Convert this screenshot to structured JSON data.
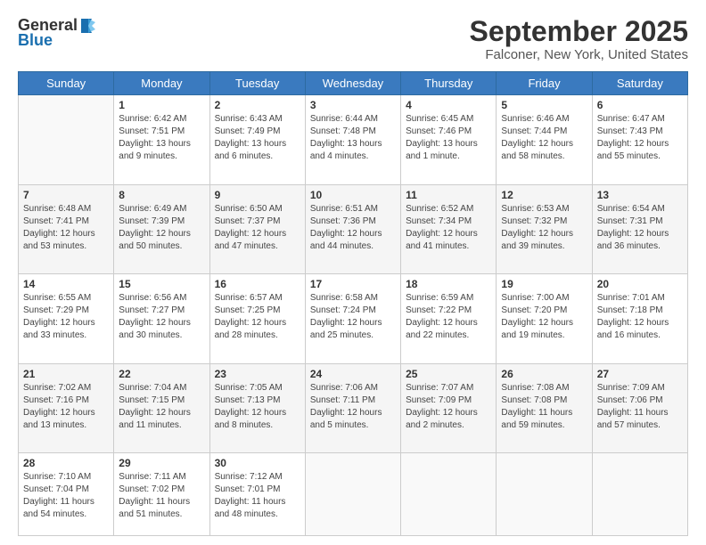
{
  "header": {
    "logo_general": "General",
    "logo_blue": "Blue",
    "month_title": "September 2025",
    "location": "Falconer, New York, United States"
  },
  "weekdays": [
    "Sunday",
    "Monday",
    "Tuesday",
    "Wednesday",
    "Thursday",
    "Friday",
    "Saturday"
  ],
  "weeks": [
    [
      {
        "day": "",
        "info": ""
      },
      {
        "day": "1",
        "info": "Sunrise: 6:42 AM\nSunset: 7:51 PM\nDaylight: 13 hours\nand 9 minutes."
      },
      {
        "day": "2",
        "info": "Sunrise: 6:43 AM\nSunset: 7:49 PM\nDaylight: 13 hours\nand 6 minutes."
      },
      {
        "day": "3",
        "info": "Sunrise: 6:44 AM\nSunset: 7:48 PM\nDaylight: 13 hours\nand 4 minutes."
      },
      {
        "day": "4",
        "info": "Sunrise: 6:45 AM\nSunset: 7:46 PM\nDaylight: 13 hours\nand 1 minute."
      },
      {
        "day": "5",
        "info": "Sunrise: 6:46 AM\nSunset: 7:44 PM\nDaylight: 12 hours\nand 58 minutes."
      },
      {
        "day": "6",
        "info": "Sunrise: 6:47 AM\nSunset: 7:43 PM\nDaylight: 12 hours\nand 55 minutes."
      }
    ],
    [
      {
        "day": "7",
        "info": "Sunrise: 6:48 AM\nSunset: 7:41 PM\nDaylight: 12 hours\nand 53 minutes."
      },
      {
        "day": "8",
        "info": "Sunrise: 6:49 AM\nSunset: 7:39 PM\nDaylight: 12 hours\nand 50 minutes."
      },
      {
        "day": "9",
        "info": "Sunrise: 6:50 AM\nSunset: 7:37 PM\nDaylight: 12 hours\nand 47 minutes."
      },
      {
        "day": "10",
        "info": "Sunrise: 6:51 AM\nSunset: 7:36 PM\nDaylight: 12 hours\nand 44 minutes."
      },
      {
        "day": "11",
        "info": "Sunrise: 6:52 AM\nSunset: 7:34 PM\nDaylight: 12 hours\nand 41 minutes."
      },
      {
        "day": "12",
        "info": "Sunrise: 6:53 AM\nSunset: 7:32 PM\nDaylight: 12 hours\nand 39 minutes."
      },
      {
        "day": "13",
        "info": "Sunrise: 6:54 AM\nSunset: 7:31 PM\nDaylight: 12 hours\nand 36 minutes."
      }
    ],
    [
      {
        "day": "14",
        "info": "Sunrise: 6:55 AM\nSunset: 7:29 PM\nDaylight: 12 hours\nand 33 minutes."
      },
      {
        "day": "15",
        "info": "Sunrise: 6:56 AM\nSunset: 7:27 PM\nDaylight: 12 hours\nand 30 minutes."
      },
      {
        "day": "16",
        "info": "Sunrise: 6:57 AM\nSunset: 7:25 PM\nDaylight: 12 hours\nand 28 minutes."
      },
      {
        "day": "17",
        "info": "Sunrise: 6:58 AM\nSunset: 7:24 PM\nDaylight: 12 hours\nand 25 minutes."
      },
      {
        "day": "18",
        "info": "Sunrise: 6:59 AM\nSunset: 7:22 PM\nDaylight: 12 hours\nand 22 minutes."
      },
      {
        "day": "19",
        "info": "Sunrise: 7:00 AM\nSunset: 7:20 PM\nDaylight: 12 hours\nand 19 minutes."
      },
      {
        "day": "20",
        "info": "Sunrise: 7:01 AM\nSunset: 7:18 PM\nDaylight: 12 hours\nand 16 minutes."
      }
    ],
    [
      {
        "day": "21",
        "info": "Sunrise: 7:02 AM\nSunset: 7:16 PM\nDaylight: 12 hours\nand 13 minutes."
      },
      {
        "day": "22",
        "info": "Sunrise: 7:04 AM\nSunset: 7:15 PM\nDaylight: 12 hours\nand 11 minutes."
      },
      {
        "day": "23",
        "info": "Sunrise: 7:05 AM\nSunset: 7:13 PM\nDaylight: 12 hours\nand 8 minutes."
      },
      {
        "day": "24",
        "info": "Sunrise: 7:06 AM\nSunset: 7:11 PM\nDaylight: 12 hours\nand 5 minutes."
      },
      {
        "day": "25",
        "info": "Sunrise: 7:07 AM\nSunset: 7:09 PM\nDaylight: 12 hours\nand 2 minutes."
      },
      {
        "day": "26",
        "info": "Sunrise: 7:08 AM\nSunset: 7:08 PM\nDaylight: 11 hours\nand 59 minutes."
      },
      {
        "day": "27",
        "info": "Sunrise: 7:09 AM\nSunset: 7:06 PM\nDaylight: 11 hours\nand 57 minutes."
      }
    ],
    [
      {
        "day": "28",
        "info": "Sunrise: 7:10 AM\nSunset: 7:04 PM\nDaylight: 11 hours\nand 54 minutes."
      },
      {
        "day": "29",
        "info": "Sunrise: 7:11 AM\nSunset: 7:02 PM\nDaylight: 11 hours\nand 51 minutes."
      },
      {
        "day": "30",
        "info": "Sunrise: 7:12 AM\nSunset: 7:01 PM\nDaylight: 11 hours\nand 48 minutes."
      },
      {
        "day": "",
        "info": ""
      },
      {
        "day": "",
        "info": ""
      },
      {
        "day": "",
        "info": ""
      },
      {
        "day": "",
        "info": ""
      }
    ]
  ]
}
